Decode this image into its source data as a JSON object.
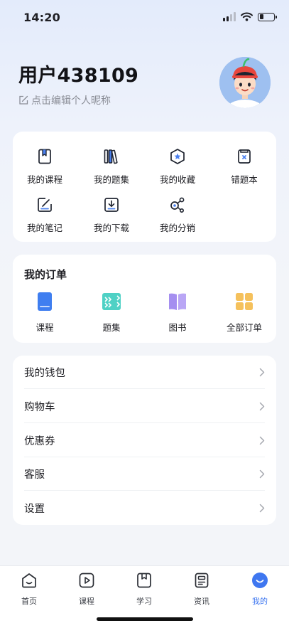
{
  "status_bar": {
    "time": "14:20",
    "battery_level": 0.3
  },
  "profile": {
    "username": "用户438109",
    "edit_hint": "点击编辑个人昵称"
  },
  "quick_links": [
    {
      "label": "我的课程",
      "icon": "course-book-icon"
    },
    {
      "label": "我的题集",
      "icon": "question-set-icon"
    },
    {
      "label": "我的收藏",
      "icon": "favorite-star-icon"
    },
    {
      "label": "错题本",
      "icon": "wrong-questions-icon"
    },
    {
      "label": "我的笔记",
      "icon": "notes-icon"
    },
    {
      "label": "我的下载",
      "icon": "download-icon"
    },
    {
      "label": "我的分销",
      "icon": "share-distribution-icon"
    }
  ],
  "orders": {
    "title": "我的订单",
    "items": [
      {
        "label": "课程",
        "icon": "course-order-icon",
        "color": "#3f7ef0"
      },
      {
        "label": "题集",
        "icon": "question-order-icon",
        "color": "#4fd1c5"
      },
      {
        "label": "图书",
        "icon": "book-order-icon",
        "color": "#a58ff0"
      },
      {
        "label": "全部订单",
        "icon": "all-orders-icon",
        "color": "#f5c15c"
      }
    ]
  },
  "menu": [
    {
      "label": "我的钱包"
    },
    {
      "label": "购物车"
    },
    {
      "label": "优惠券"
    },
    {
      "label": "客服"
    },
    {
      "label": "设置"
    }
  ],
  "tabbar": {
    "active_color": "#3f77f0",
    "items": [
      {
        "label": "首页",
        "icon": "home-icon"
      },
      {
        "label": "课程",
        "icon": "play-icon"
      },
      {
        "label": "学习",
        "icon": "study-bookmark-icon"
      },
      {
        "label": "资讯",
        "icon": "news-icon"
      },
      {
        "label": "我的",
        "icon": "profile-smile-icon",
        "active": true
      }
    ]
  }
}
